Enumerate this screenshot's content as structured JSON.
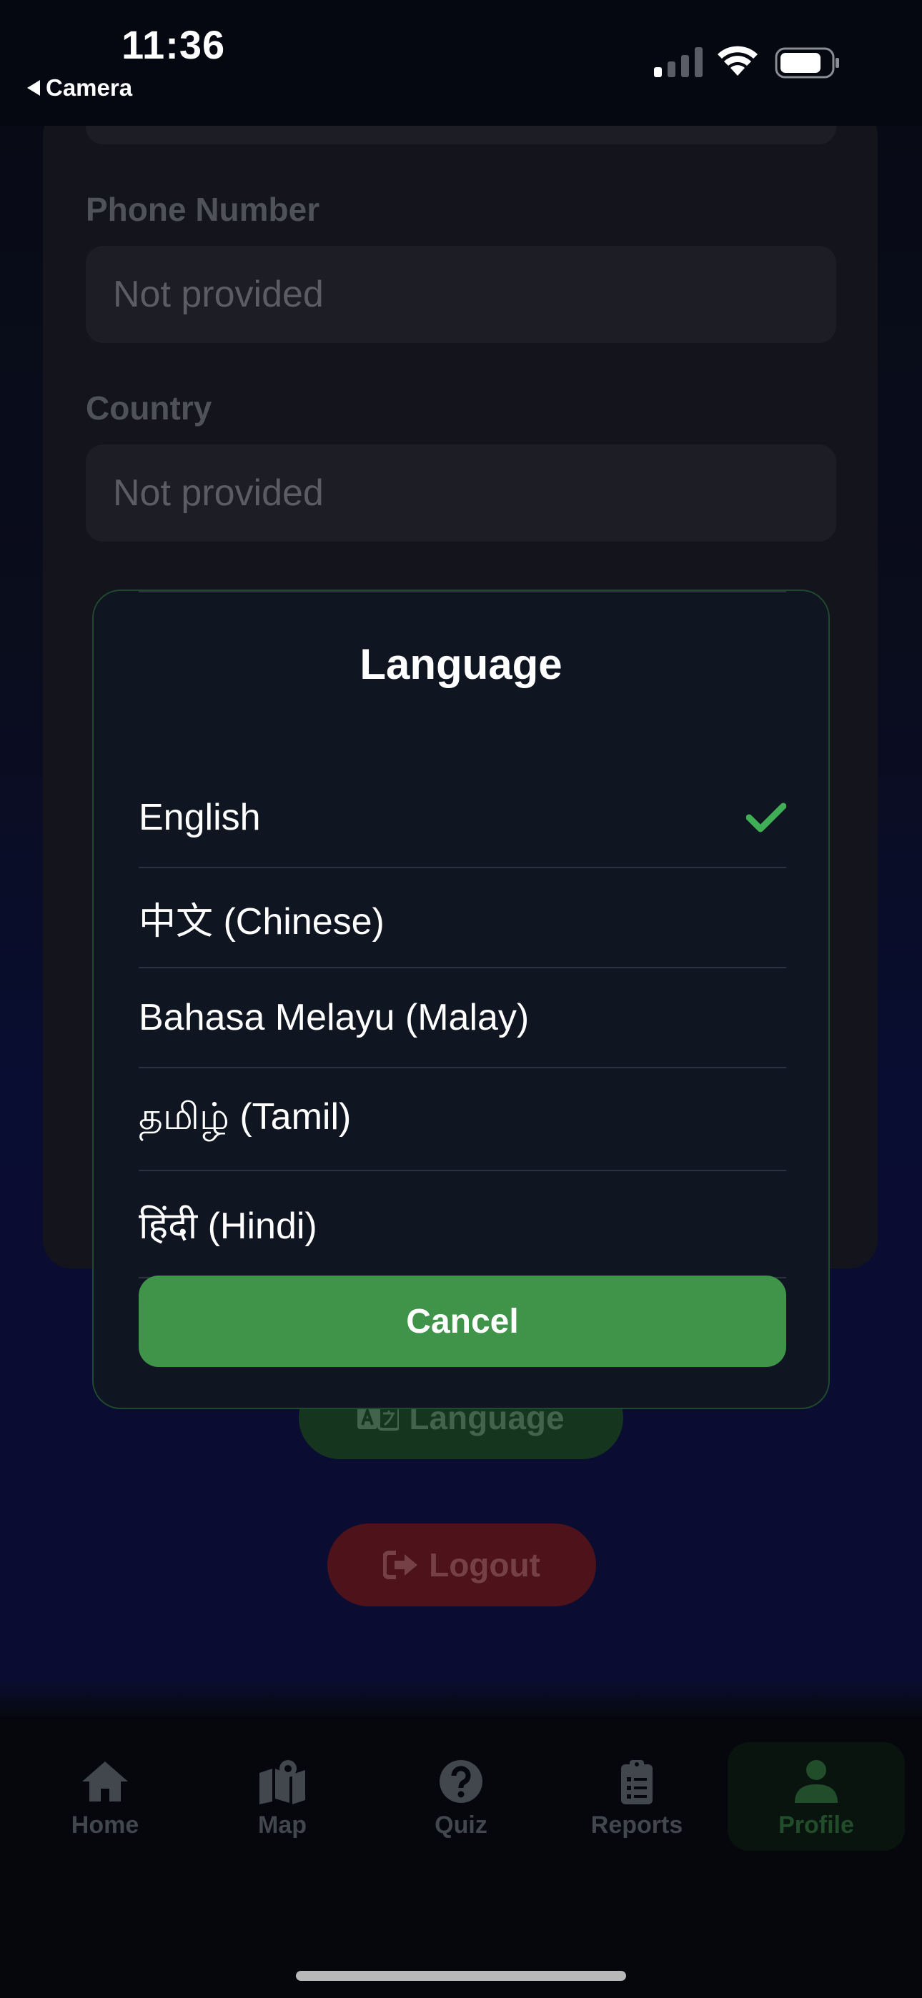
{
  "status_bar": {
    "time": "11:36",
    "back_app": "Camera"
  },
  "profile_form": {
    "fields": [
      {
        "label": "Phone Number",
        "value": "Not provided"
      },
      {
        "label": "Country",
        "value": "Not provided"
      }
    ]
  },
  "actions": {
    "language_label": "Language",
    "logout_label": "Logout"
  },
  "language_modal": {
    "title": "Language",
    "options": [
      {
        "label": "English",
        "selected": true
      },
      {
        "label": "中文 (Chinese)",
        "selected": false
      },
      {
        "label": "Bahasa Melayu (Malay)",
        "selected": false
      },
      {
        "label": "தமிழ் (Tamil)",
        "selected": false
      },
      {
        "label": "हिंदी (Hindi)",
        "selected": false
      }
    ],
    "cancel_label": "Cancel",
    "accent_color": "#40944a"
  },
  "tab_bar": {
    "items": [
      {
        "label": "Home",
        "icon": "home-icon"
      },
      {
        "label": "Map",
        "icon": "map-icon"
      },
      {
        "label": "Quiz",
        "icon": "question-icon"
      },
      {
        "label": "Reports",
        "icon": "clipboard-icon"
      },
      {
        "label": "Profile",
        "icon": "user-icon",
        "active": true
      }
    ]
  }
}
